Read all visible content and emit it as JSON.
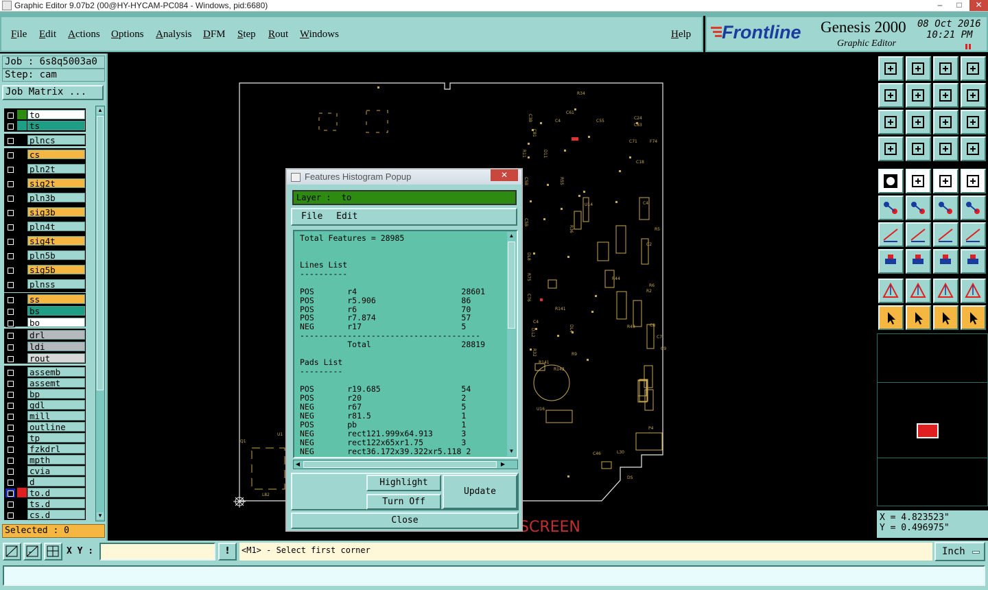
{
  "window": {
    "title": "Graphic Editor 9.07b2 (00@HY-HYCAM-PC084 - Windows, pid:6680)"
  },
  "menu": {
    "items": [
      "File",
      "Edit",
      "Actions",
      "Options",
      "Analysis",
      "DFM",
      "Step",
      "Rout",
      "Windows"
    ],
    "help": "Help"
  },
  "brand": {
    "logo": "Frontline",
    "product": "Genesis 2000",
    "subtitle": "Graphic Editor",
    "date": "08 Oct 2016",
    "time": "10:21 PM"
  },
  "left": {
    "job": "Job : 6s8q5003a0",
    "step": "Step: cam",
    "job_matrix": "Job Matrix ...",
    "selected": "Selected : 0"
  },
  "layers": [
    {
      "name": "to",
      "color": "#ffffff",
      "swatch": "#2e8b12"
    },
    {
      "name": "ts",
      "color": "#1f9e86",
      "swatch": "#1f9e86"
    },
    {
      "name": "plncs",
      "color": "#9fd6d0"
    },
    {
      "name": "cs",
      "color": "#f5b642"
    },
    {
      "name": "pln2t",
      "color": "#9fd6d0"
    },
    {
      "name": "sig2t",
      "color": "#f5b642"
    },
    {
      "name": "pln3b",
      "color": "#9fd6d0"
    },
    {
      "name": "sig3b",
      "color": "#f5b642"
    },
    {
      "name": "pln4t",
      "color": "#9fd6d0"
    },
    {
      "name": "sig4t",
      "color": "#f5b642"
    },
    {
      "name": "pln5b",
      "color": "#9fd6d0"
    },
    {
      "name": "sig5b",
      "color": "#f5b642"
    },
    {
      "name": "plnss",
      "color": "#9fd6d0"
    },
    {
      "name": "ss",
      "color": "#f5b642"
    },
    {
      "name": "bs",
      "color": "#1f9e86"
    },
    {
      "name": "bo",
      "color": "#ffffff"
    },
    {
      "name": "drl",
      "color": "#b5b8bd"
    },
    {
      "name": "ldi",
      "color": "#b5b8bd"
    },
    {
      "name": "rout",
      "color": "#d8d8d8"
    },
    {
      "name": "assemb",
      "color": "#9fd6d0"
    },
    {
      "name": "assemt",
      "color": "#9fd6d0"
    },
    {
      "name": "bp",
      "color": "#9fd6d0"
    },
    {
      "name": "gdl",
      "color": "#9fd6d0"
    },
    {
      "name": "mill",
      "color": "#9fd6d0"
    },
    {
      "name": "outline",
      "color": "#9fd6d0"
    },
    {
      "name": "tp",
      "color": "#9fd6d0"
    },
    {
      "name": "fzkdrl",
      "color": "#9fd6d0"
    },
    {
      "name": "mpth",
      "color": "#9fd6d0"
    },
    {
      "name": "cvia",
      "color": "#9fd6d0"
    },
    {
      "name": "d",
      "color": "#9fd6d0"
    },
    {
      "name": "to.d",
      "color": "#9fd6d0",
      "swatch": "#e02020",
      "active": true
    },
    {
      "name": "ts.d",
      "color": "#9fd6d0"
    },
    {
      "name": "cs.d",
      "color": "#9fd6d0"
    }
  ],
  "popup": {
    "title": "Features Histogram Popup",
    "layer_label": "Layer :",
    "layer_value": "to",
    "menu_file": "File",
    "menu_edit": "Edit",
    "lines": [
      "Total Features = 28985",
      "",
      "",
      "Lines List",
      "----------",
      "",
      "POS       r4                      28601",
      "POS       r5.906                  86",
      "POS       r6                      70",
      "POS       r7.874                  57",
      "NEG       r17                     5",
      "--------------------------------------",
      "          Total                   28819",
      "",
      "Pads List",
      "---------",
      "",
      "POS       r19.685                 54",
      "POS       r20                     2",
      "NEG       r67                     5",
      "NEG       r81.5                   1",
      "POS       pb                      1",
      "NEG       rect121.999x64.913      3",
      "NEG       rect122x65xr1.75        3",
      "NEG       rect36.172x39.322xr5.118 2"
    ],
    "btn_highlight": "Highlight",
    "btn_turnoff": "Turn Off",
    "btn_update": "Update",
    "btn_close": "Close"
  },
  "canvas": {
    "screen_text": "SCREEN"
  },
  "coords": {
    "x": "X  =  4.823523\"",
    "y": "Y  =  0.496975\""
  },
  "bottom": {
    "xy_label": "X Y :",
    "xy_value": "",
    "prompt": "<M1> - Select first corner",
    "units": "Inch"
  },
  "colors": {
    "panel": "#9fd6d0",
    "orange": "#f5b642",
    "teal": "#1f9e86",
    "pcb_yellow": "#c8a850"
  }
}
